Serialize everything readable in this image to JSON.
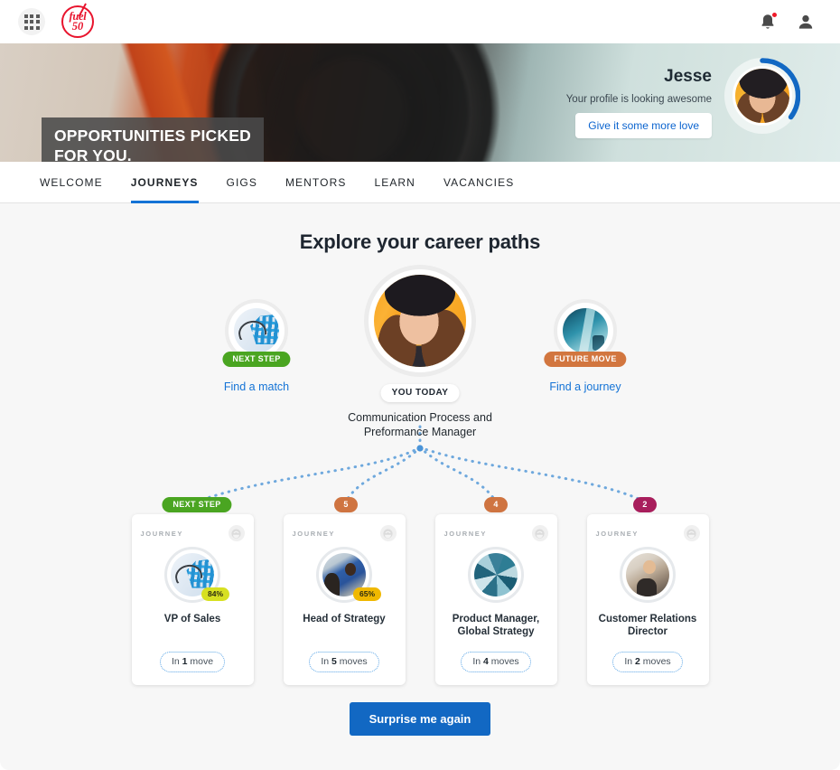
{
  "topbar": {
    "apps_label": "apps-grid",
    "logo_line1": "fuel",
    "logo_line2": "50",
    "bell_label": "Notifications",
    "profile_label": "Profile"
  },
  "hero": {
    "banner_line1": "OPPORTUNITIES PICKED",
    "banner_line2": "FOR YOU.",
    "user_name": "Jesse",
    "user_subtitle": "Your profile is looking awesome",
    "cta_label": "Give it some more love",
    "ring_percent": 30,
    "ring_color": "#1268c3"
  },
  "nav": {
    "items": [
      {
        "label": "WELCOME",
        "active": false
      },
      {
        "label": "JOURNEYS",
        "active": true
      },
      {
        "label": "GIGS",
        "active": false
      },
      {
        "label": "MENTORS",
        "active": false
      },
      {
        "label": "LEARN",
        "active": false
      },
      {
        "label": "VACANCIES",
        "active": false
      }
    ],
    "active_underline_color": "#1473d6"
  },
  "main": {
    "title": "Explore your career paths",
    "left_node": {
      "badge": "NEXT STEP",
      "badge_color": "#4aa521",
      "link": "Find a match"
    },
    "center_node": {
      "badge": "YOU TODAY",
      "role_line1": "Communication Process and",
      "role_line2": "Preformance Manager"
    },
    "right_node": {
      "badge": "FUTURE MOVE",
      "badge_color": "#d2763f",
      "link": "Find a journey"
    },
    "branch_badges": [
      {
        "label": "NEXT STEP",
        "style": "green"
      },
      {
        "label": "5",
        "style": "orange"
      },
      {
        "label": "4",
        "style": "orange"
      },
      {
        "label": "2",
        "style": "maroon"
      }
    ],
    "cards": [
      {
        "kicker": "JOURNEY",
        "title": "VP of Sales",
        "percent": "84%",
        "percent_color": "#d7e021",
        "moves_prefix": "In ",
        "moves_count": "1",
        "moves_suffix": " move"
      },
      {
        "kicker": "JOURNEY",
        "title": "Head of Strategy",
        "percent": "65%",
        "percent_color": "#f0b800",
        "moves_prefix": "In ",
        "moves_count": "5",
        "moves_suffix": " moves"
      },
      {
        "kicker": "JOURNEY",
        "title_line1": "Product Manager,",
        "title_line2": "Global Strategy",
        "percent": "",
        "moves_prefix": "In ",
        "moves_count": "4",
        "moves_suffix": " moves"
      },
      {
        "kicker": "JOURNEY",
        "title_line1": "Customer Relations",
        "title_line2": "Director",
        "percent": "",
        "moves_prefix": "In ",
        "moves_count": "2",
        "moves_suffix": " moves"
      }
    ],
    "surprise_label": "Surprise me again",
    "surprise_color": "#1268c3",
    "connector_color": "#6ea8dd",
    "background": "#f7f7f7"
  }
}
